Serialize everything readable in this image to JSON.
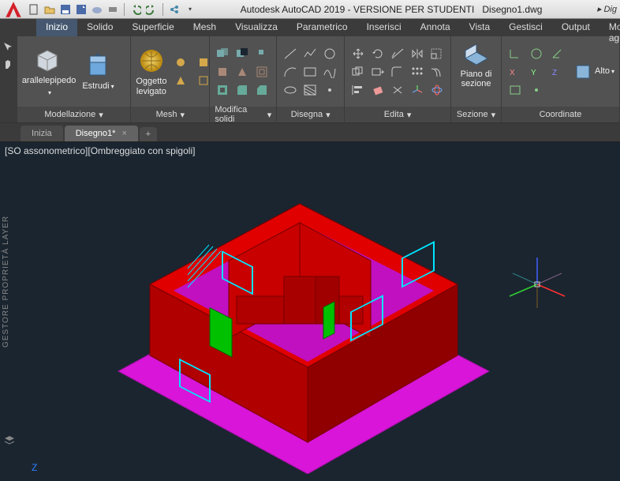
{
  "app": {
    "title": "Autodesk AutoCAD 2019 - VERSIONE PER STUDENTI",
    "file": "Disegno1.dwg",
    "right_hint": "Dig"
  },
  "menu": {
    "items": [
      "Inizio",
      "Solido",
      "Superficie",
      "Mesh",
      "Visualizza",
      "Parametrico",
      "Inserisci",
      "Annota",
      "Vista",
      "Gestisci",
      "Output",
      "Moduli aggiu"
    ],
    "active_index": 0
  },
  "ribbon": {
    "modellazione": {
      "title": "Modellazione",
      "parallelepipedo": "arallelepipedo",
      "estrudi": "Estrudi"
    },
    "mesh": {
      "title": "Mesh",
      "oggetto": "Oggetto levigato"
    },
    "modifica": {
      "title": "Modifica solidi"
    },
    "disegna": {
      "title": "Disegna"
    },
    "edita": {
      "title": "Edita"
    },
    "sezione": {
      "title": "Sezione",
      "piano": "Piano di sezione"
    },
    "coord": {
      "title": "Coordinate",
      "alto": "Alto"
    }
  },
  "tabs": {
    "start": "Inizia",
    "file": "Disegno1*"
  },
  "viewport": {
    "label": "[SO assonometrico][Ombreggiato con spigoli]",
    "side_panel": "GESTORE PROPRIETÀ LAYER",
    "axis_z": "Z"
  }
}
